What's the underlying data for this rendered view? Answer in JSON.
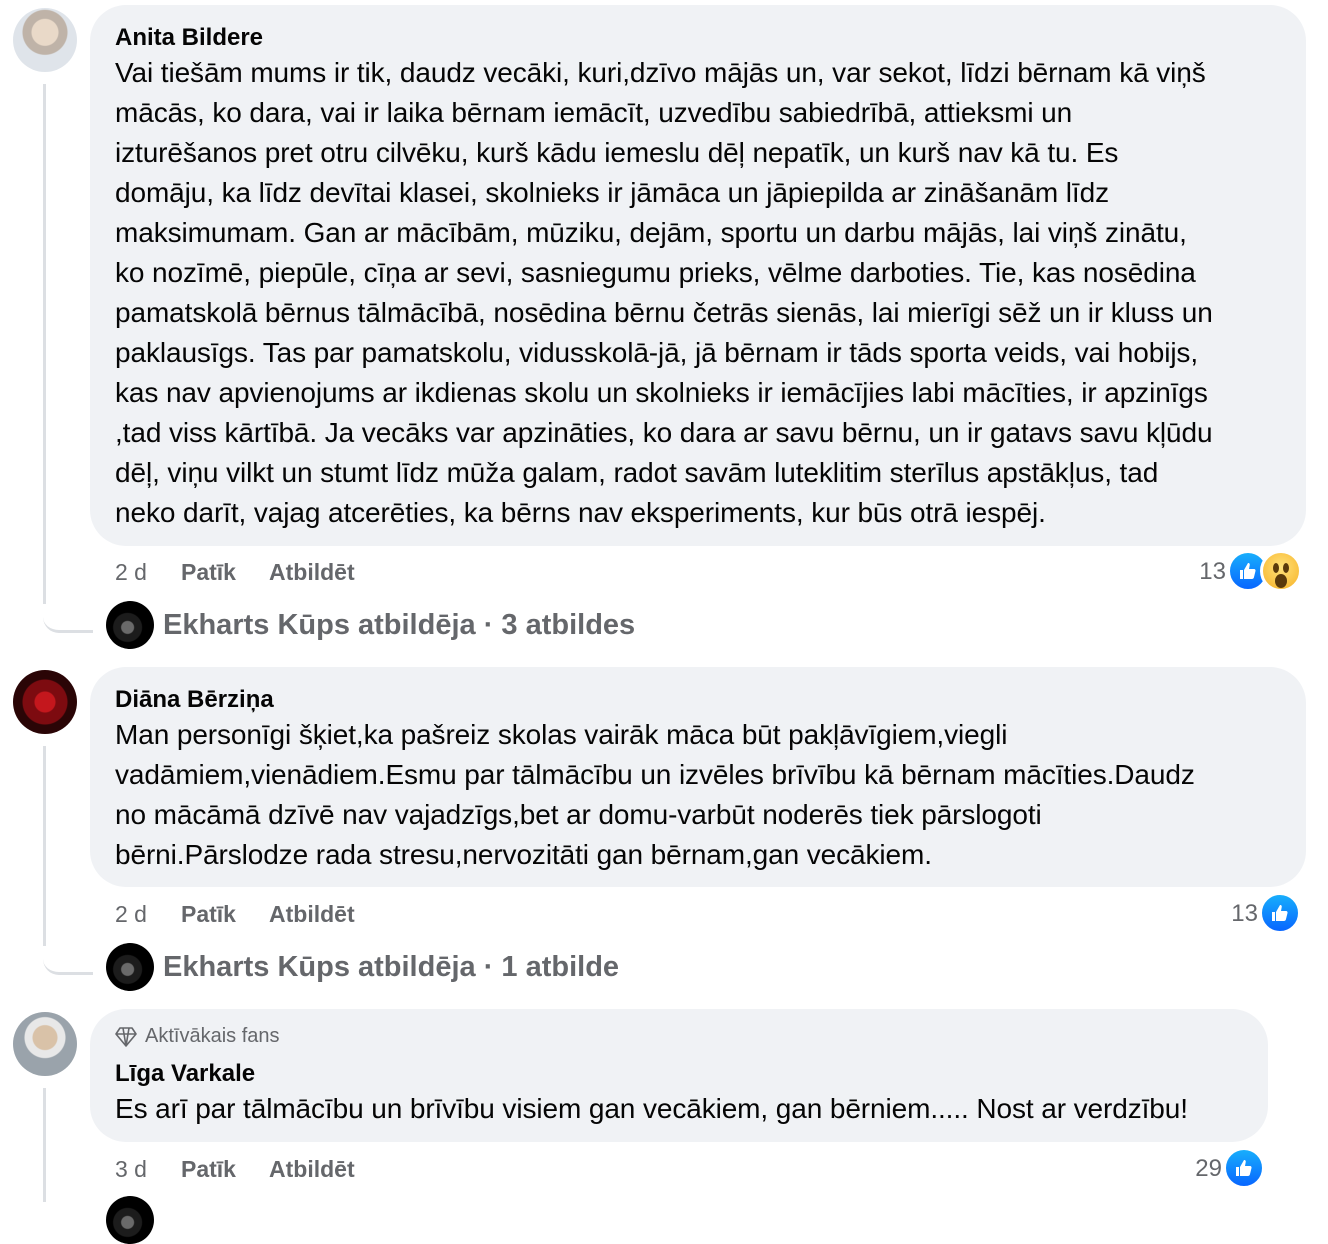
{
  "comments": [
    {
      "author": "Anita Bildere",
      "text_lines": [
        "Vai tiešām mums ir tik, daudz vecāki, kuri,dzīvo mājās un, var sekot, līdzi bērnam kā viņš",
        "mācās, ko dara, vai ir laika bērnam iemācīt, uzvedību sabiedrībā, attieksmi un",
        "izturēšanos pret otru cilvēku, kurš kādu iemeslu dēļ nepatīk, un kurš nav kā tu. Es",
        "domāju, ka līdz devītai klasei, skolnieks ir jāmāca un jāpiepilda ar zināšanām līdz",
        "maksimumam. Gan ar mācībām, mūziku, dejām, sportu un darbu mājās, lai viņš zinātu,",
        "ko nozīmē, piepūle, cīņa ar sevi, sasniegumu prieks, vēlme darboties. Tie, kas nosēdina",
        "pamatskolā bērnus tālmācībā, nosēdina bērnu četrās sienās, lai mierīgi sēž un ir kluss un",
        "paklausīgs. Tas par pamatskolu, vidusskolā-jā, jā bērnam ir tāds sporta veids, vai hobijs,",
        "kas nav apvienojums ar ikdienas skolu un skolnieks ir iemācījies labi mācīties, ir apzinīgs",
        ",tad viss kārtībā. Ja vecāks var apzināties, ko dara ar savu bērnu, un ir gatavs savu kļūdu",
        "dēļ, viņu vilkt un stumt līdz mūža galam, radot savām luteklitim sterīlus apstākļus, tad",
        "neko darīt, vajag atcerēties, ka bērns nav eksperiments, kur būs otrā iespēj."
      ],
      "time": "2 d",
      "like_label": "Patīk",
      "reply_label": "Atbildēt",
      "reaction_count": "13",
      "reactions": [
        "like",
        "wow"
      ],
      "reply_summary": "Ekharts Kūps atbildēja · 3 atbildes"
    },
    {
      "author": "Diāna Bērziņa",
      "text_lines": [
        "Man personīgi šķiet,ka pašreiz skolas vairāk māca būt pakļāvīgiem,viegli",
        "vadāmiem,vienādiem.Esmu par tālmācību un izvēles brīvību kā bērnam mācīties.Daudz",
        "no mācāmā dzīvē nav vajadzīgs,bet ar domu-varbūt noderēs tiek pārslogoti",
        "bērni.Pārslodze rada stresu,nervozitāti gan bērnam,gan vecākiem."
      ],
      "time": "2 d",
      "like_label": "Patīk",
      "reply_label": "Atbildēt",
      "reaction_count": "13",
      "reactions": [
        "like"
      ],
      "reply_summary": "Ekharts Kūps atbildēja · 1 atbilde"
    },
    {
      "badge": "Aktīvākais fans",
      "author": "Līga Varkale",
      "text_lines": [
        "Es arī par tālmācību un brīvību visiem gan vecākiem, gan bērniem..... Nost ar verdzību!"
      ],
      "time": "3 d",
      "like_label": "Patīk",
      "reply_label": "Atbildēt",
      "reaction_count": "29",
      "reactions": [
        "like"
      ]
    }
  ],
  "colors": {
    "bubble": "#f0f2f5",
    "meta_text": "#65676b",
    "like_blue": "#0866ff",
    "thread_line": "#dcdfe3"
  }
}
